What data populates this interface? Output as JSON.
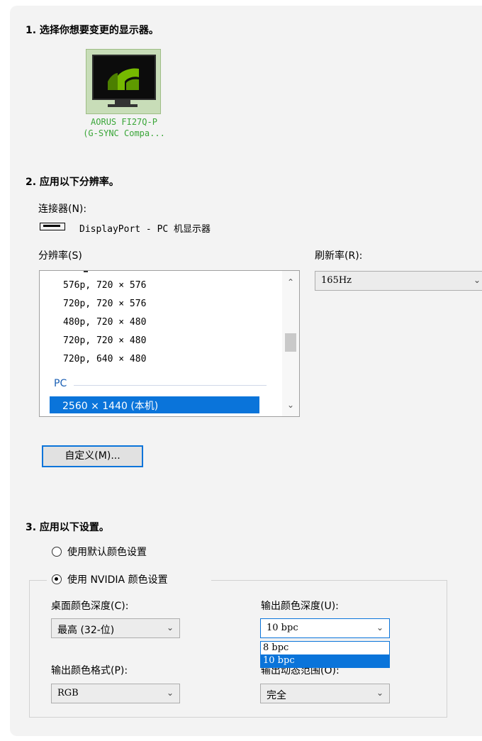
{
  "section1": {
    "title": "1. 选择你想要变更的显示器。"
  },
  "monitor": {
    "name_line1": "AORUS FI27Q-P",
    "name_line2": "(G-SYNC Compa...",
    "icon": "nvidia-monitor-icon"
  },
  "section2": {
    "title": "2. 应用以下分辨率。",
    "connector_label": "连接器(N):",
    "connector_value": "DisplayPort - PC 机显示器",
    "resolution_label": "分辨率(S)",
    "refresh_label": "刷新率(R):",
    "refresh_value": "165Hz",
    "resolutions": [
      "576p, 720 × 576",
      "720p, 720 × 576",
      "480p, 720 × 480",
      "720p, 720 × 480",
      "720p, 640 × 480"
    ],
    "group_label": "PC",
    "selected_resolution": "2560 × 1440 (本机)",
    "custom_button": "自定义(M)..."
  },
  "section3": {
    "title": "3. 应用以下设置。",
    "radio_default": "使用默认颜色设置",
    "radio_nvidia": "使用 NVIDIA 颜色设置",
    "desktop_depth_label": "桌面颜色深度(C):",
    "desktop_depth_value": "最高 (32-位)",
    "output_depth_label": "输出颜色深度(U):",
    "output_depth_value": "10 bpc",
    "output_depth_options": [
      "8 bpc",
      "10 bpc"
    ],
    "output_format_label": "输出颜色格式(P):",
    "output_format_value": "RGB",
    "output_range_label": "输出动态范围(O):",
    "output_range_value": "完全"
  },
  "colors": {
    "accent": "#0a74da",
    "nvidia_green": "#76b900",
    "group_blue": "#1a5fb4"
  }
}
